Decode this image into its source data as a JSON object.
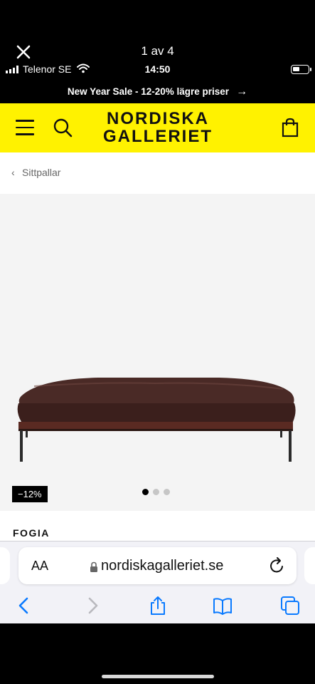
{
  "viewer": {
    "counter": "1 av 4"
  },
  "status_bar": {
    "carrier": "Telenor SE",
    "time": "14:50"
  },
  "promo": {
    "text": "New Year Sale - 12-20% lägre priser",
    "arrow": "→"
  },
  "header": {
    "logo_line1": "NORDISKA",
    "logo_line2": "GALLERIET",
    "accent_color": "#fff200"
  },
  "breadcrumb": {
    "label": "Sittpallar"
  },
  "gallery": {
    "discount_badge": "−12%",
    "image_count": 3,
    "active_image": 1
  },
  "product": {
    "brand": "FOGIA"
  },
  "browser": {
    "aa_label": "AA",
    "url": "nordiskagalleriet.se",
    "accent_color": "#0a7aff"
  }
}
